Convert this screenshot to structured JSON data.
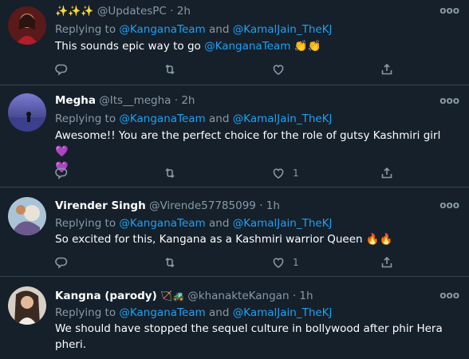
{
  "tweets": [
    {
      "name": "✨✨✨",
      "handle": "@UpdatesPC",
      "time": "· 2h",
      "reply_prefix": "Replying to",
      "reply_to_1": "@KanganaTeam",
      "reply_and": "and",
      "reply_to_2": "@KamalJain_TheKJ",
      "text": "This sounds epic way to go",
      "text_mention": "@KanganaTeam",
      "text_emoji": "👏👏",
      "like_count": ""
    },
    {
      "name": "Megha",
      "handle": "@Its__megha",
      "time": "· 2h",
      "reply_prefix": "Replying to",
      "reply_to_1": "@KanganaTeam",
      "reply_and": "and",
      "reply_to_2": "@KamalJain_TheKJ",
      "text": "Awesome!! You are the perfect choice for the role of  gutsy Kashmiri girl",
      "text_emoji": "💜",
      "text_emoji_2": "💜",
      "like_count": "1"
    },
    {
      "name": "Virender Singh",
      "handle": "@Virende57785099",
      "time": "· 1h",
      "reply_prefix": "Replying to",
      "reply_to_1": "@KanganaTeam",
      "reply_and": "and",
      "reply_to_2": "@KamalJain_TheKJ",
      "text": "So excited for this, Kangana as a Kashmiri warrior Queen",
      "text_emoji": "🔥🔥",
      "like_count": "1"
    },
    {
      "name": "Kangna (parody)",
      "name_emoji": "🏹🚜",
      "handle": "@khanakteKangan",
      "time": "· 1h",
      "reply_prefix": "Replying to",
      "reply_to_1": "@KanganaTeam",
      "reply_and": "and",
      "reply_to_2": "@KamalJain_TheKJ",
      "text_line1": "We should have stopped the sequel culture in bollywood after phir Hera",
      "text_line2": "pheri."
    }
  ],
  "more_glyph": "ooo",
  "icons": [
    "reply-icon",
    "retweet-icon",
    "like-icon",
    "share-icon",
    "more-icon"
  ],
  "colors": {
    "background": "#15202b",
    "accent": "#1da1f2",
    "muted": "#8899a6",
    "divider": "#38444d"
  }
}
